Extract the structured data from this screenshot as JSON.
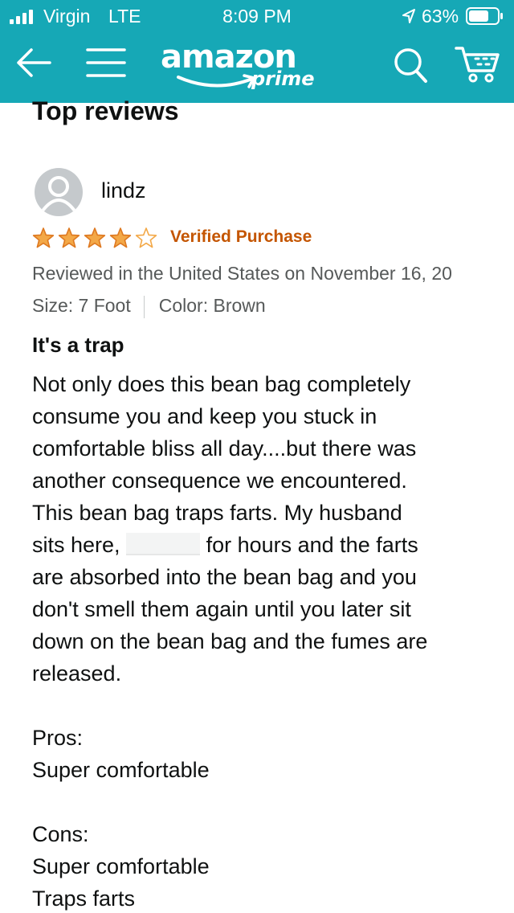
{
  "status_bar": {
    "carrier": "Virgin",
    "network": "LTE",
    "time": "8:09 PM",
    "battery": "63%"
  },
  "nav": {
    "logo_text": "amazon",
    "logo_sub": "prime",
    "brand_color": "#16a8b6"
  },
  "reviews": {
    "section_title": "Top reviews",
    "review": {
      "reviewer": "lindz",
      "rating": 4,
      "max_rating": 5,
      "verified": "Verified Purchase",
      "date_line": "Reviewed in the United States on November 16, 20",
      "size": "Size: 7 Foot",
      "color": "Color: Brown",
      "title": "It's a trap",
      "body": {
        "line1": "Not only does this bean bag completely",
        "line2": "consume you and keep you stuck in",
        "line3": "comfortable bliss all day....but there was",
        "line4": "another consequence we encountered.",
        "line5": "This bean bag traps farts. My husband",
        "line6_a": "sits here,",
        "line6_b": "for hours and the farts",
        "line7": "are absorbed into the bean bag and you",
        "line8": "don't smell them again until you later sit",
        "line9": "down on the bean bag and the fumes are",
        "line10": "released.",
        "pros_label": "Pros:",
        "pros1": "Super comfortable",
        "cons_label": "Cons:",
        "cons1": "Super comfortable",
        "cons2": "Traps farts"
      }
    }
  },
  "colors": {
    "header": "#16a8b6",
    "star": "#f3a847",
    "verified": "#c45500",
    "meta": "#565959"
  }
}
